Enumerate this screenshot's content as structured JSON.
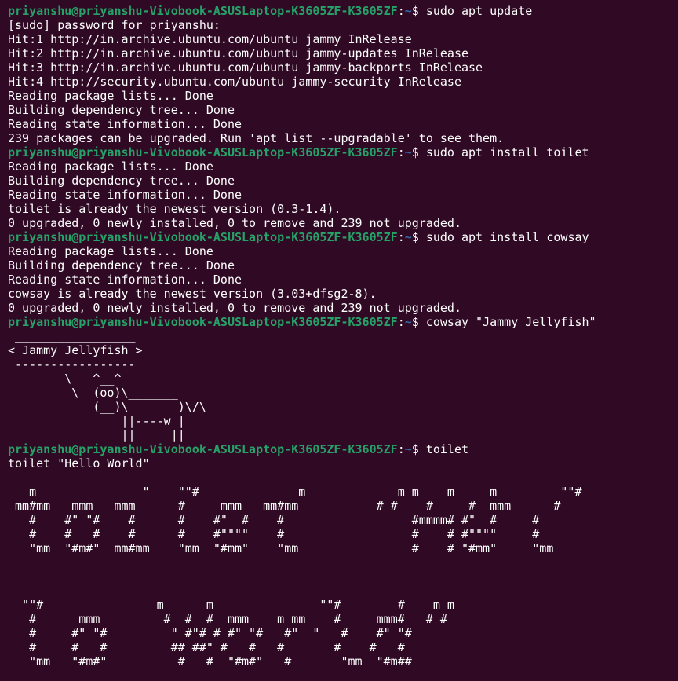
{
  "colors": {
    "background": "#300a24",
    "foreground": "#ffffff",
    "prompt_user": "#26a269",
    "prompt_path": "#3465a4"
  },
  "lines": [
    {
      "type": "prompt",
      "user": "priyanshu@priyanshu-Vivobook-ASUSLaptop-K3605ZF-K3605ZF",
      "sep": ":",
      "path": "~",
      "dollar": "$ ",
      "cmd": "sudo apt update"
    },
    {
      "type": "out",
      "text": "[sudo] password for priyanshu:"
    },
    {
      "type": "out",
      "text": "Hit:1 http://in.archive.ubuntu.com/ubuntu jammy InRelease"
    },
    {
      "type": "out",
      "text": "Hit:2 http://in.archive.ubuntu.com/ubuntu jammy-updates InRelease"
    },
    {
      "type": "out",
      "text": "Hit:3 http://in.archive.ubuntu.com/ubuntu jammy-backports InRelease"
    },
    {
      "type": "out",
      "text": "Hit:4 http://security.ubuntu.com/ubuntu jammy-security InRelease"
    },
    {
      "type": "out",
      "text": "Reading package lists... Done"
    },
    {
      "type": "out",
      "text": "Building dependency tree... Done"
    },
    {
      "type": "out",
      "text": "Reading state information... Done"
    },
    {
      "type": "out",
      "text": "239 packages can be upgraded. Run 'apt list --upgradable' to see them."
    },
    {
      "type": "prompt",
      "user": "priyanshu@priyanshu-Vivobook-ASUSLaptop-K3605ZF-K3605ZF",
      "sep": ":",
      "path": "~",
      "dollar": "$ ",
      "cmd": "sudo apt install toilet"
    },
    {
      "type": "out",
      "text": "Reading package lists... Done"
    },
    {
      "type": "out",
      "text": "Building dependency tree... Done"
    },
    {
      "type": "out",
      "text": "Reading state information... Done"
    },
    {
      "type": "out",
      "text": "toilet is already the newest version (0.3-1.4)."
    },
    {
      "type": "out",
      "text": "0 upgraded, 0 newly installed, 0 to remove and 239 not upgraded."
    },
    {
      "type": "prompt",
      "user": "priyanshu@priyanshu-Vivobook-ASUSLaptop-K3605ZF-K3605ZF",
      "sep": ":",
      "path": "~",
      "dollar": "$ ",
      "cmd": "sudo apt install cowsay"
    },
    {
      "type": "out",
      "text": "Reading package lists... Done"
    },
    {
      "type": "out",
      "text": "Building dependency tree... Done"
    },
    {
      "type": "out",
      "text": "Reading state information... Done"
    },
    {
      "type": "out",
      "text": "cowsay is already the newest version (3.03+dfsg2-8)."
    },
    {
      "type": "out",
      "text": "0 upgraded, 0 newly installed, 0 to remove and 239 not upgraded."
    },
    {
      "type": "prompt",
      "user": "priyanshu@priyanshu-Vivobook-ASUSLaptop-K3605ZF-K3605ZF",
      "sep": ":",
      "path": "~",
      "dollar": "$ ",
      "cmd": "cowsay \"Jammy Jellyfish\""
    },
    {
      "type": "out",
      "text": " _________________"
    },
    {
      "type": "out",
      "text": "< Jammy Jellyfish >"
    },
    {
      "type": "out",
      "text": " -----------------"
    },
    {
      "type": "out",
      "text": "        \\   ^__^"
    },
    {
      "type": "out",
      "text": "         \\  (oo)\\_______"
    },
    {
      "type": "out",
      "text": "            (__)\\       )\\/\\"
    },
    {
      "type": "out",
      "text": "                ||----w |"
    },
    {
      "type": "out",
      "text": "                ||     ||"
    },
    {
      "type": "prompt",
      "user": "priyanshu@priyanshu-Vivobook-ASUSLaptop-K3605ZF-K3605ZF",
      "sep": ":",
      "path": "~",
      "dollar": "$ ",
      "cmd": "toilet"
    },
    {
      "type": "out",
      "text": "toilet \"Hello World\""
    },
    {
      "type": "out",
      "text": ""
    },
    {
      "type": "out",
      "text": "   m               \"    \"\"#              m             m m    m     m         \"\"#"
    },
    {
      "type": "out",
      "text": " mm#mm   mmm   mmm      #     mmm   mm#mm           # #    #     #  mmm      #"
    },
    {
      "type": "out",
      "text": "   #    #\" \"#    #      #    #\"  #    #                  #mmmm# #\"  #     #"
    },
    {
      "type": "out",
      "text": "   #    #   #    #      #    #\"\"\"\"    #                  #    # #\"\"\"\"     #"
    },
    {
      "type": "out",
      "text": "   \"mm  \"#m#\"  mm#mm    \"mm  \"#mm\"    \"mm                #    # \"#mm\"     \"mm"
    },
    {
      "type": "out",
      "text": ""
    },
    {
      "type": "out",
      "text": ""
    },
    {
      "type": "out",
      "text": ""
    },
    {
      "type": "out",
      "text": "  \"\"#                m      m               \"\"#        #    m m"
    },
    {
      "type": "out",
      "text": "   #      mmm         #  #  #  mmm    m mm    #     mmm#   # #"
    },
    {
      "type": "out",
      "text": "   #     #\" \"#         \" #\"# # #\" \"#   #\"  \"   #    #\" \"#"
    },
    {
      "type": "out",
      "text": "   #     #   #         ## ##\" #   #   #       #    #   #"
    },
    {
      "type": "out",
      "text": "   \"mm   \"#m#\"          #   #  \"#m#\"   #       \"mm  \"#m##"
    }
  ]
}
